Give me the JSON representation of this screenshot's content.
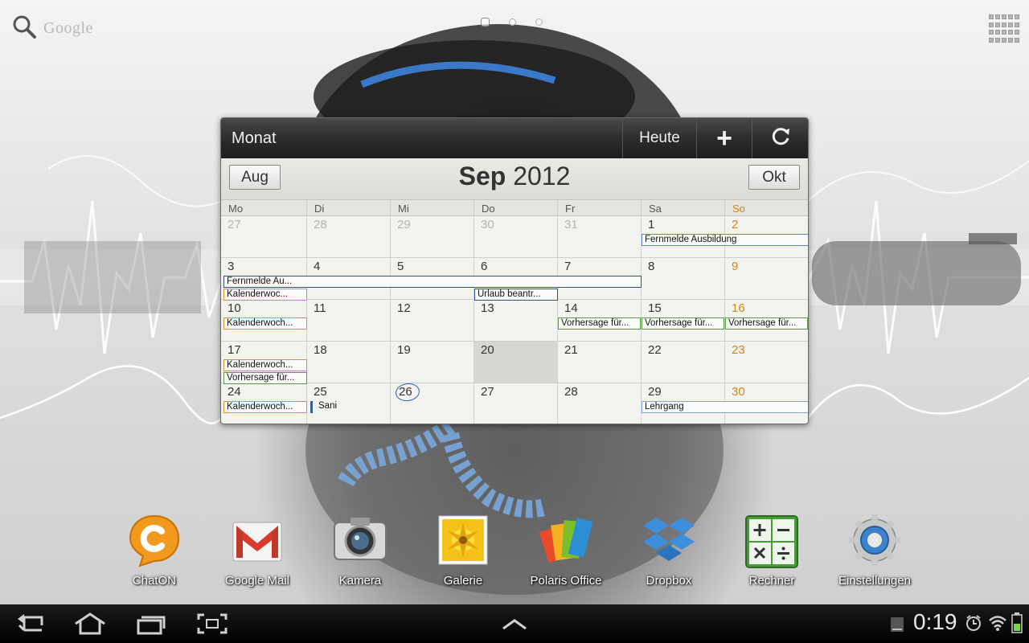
{
  "search": {
    "label": "Google"
  },
  "calendar": {
    "view_label": "Monat",
    "today_label": "Heute",
    "add_label": "+",
    "prev_month": "Aug",
    "next_month": "Okt",
    "month": "Sep",
    "year": "2012",
    "weekdays": [
      "Mo",
      "Di",
      "Mi",
      "Do",
      "Fr",
      "Sa",
      "So"
    ],
    "weeks": [
      [
        "27",
        "28",
        "29",
        "30",
        "31",
        "1",
        "2"
      ],
      [
        "3",
        "4",
        "5",
        "6",
        "7",
        "8",
        "9"
      ],
      [
        "10",
        "11",
        "12",
        "13",
        "14",
        "15",
        "16"
      ],
      [
        "17",
        "18",
        "19",
        "20",
        "21",
        "22",
        "23"
      ],
      [
        "24",
        "25",
        "26",
        "27",
        "28",
        "29",
        "30"
      ]
    ],
    "today": "26",
    "events": {
      "fernmelde_ausbildung": "Fernmelde Ausbildung",
      "fernmelde_au": "Fernmelde Au...",
      "kalenderwoc": "Kalenderwoc...",
      "urlaub": "Urlaub beantr...",
      "kalenderwoch": "Kalenderwoch...",
      "vorhersage": "Vorhersage für...",
      "sani": "Sani",
      "lehrgang": "Lehrgang"
    }
  },
  "dock": [
    {
      "label": "ChatON",
      "icon": "chaton-icon"
    },
    {
      "label": "Google Mail",
      "icon": "gmail-icon"
    },
    {
      "label": "Kamera",
      "icon": "camera-icon"
    },
    {
      "label": "Galerie",
      "icon": "gallery-icon"
    },
    {
      "label": "Polaris Office",
      "icon": "polaris-office-icon"
    },
    {
      "label": "Dropbox",
      "icon": "dropbox-icon"
    },
    {
      "label": "Rechner",
      "icon": "calculator-icon"
    },
    {
      "label": "Einstellungen",
      "icon": "settings-icon"
    }
  ],
  "status": {
    "time": "0:19"
  },
  "colors": {
    "sunday": "#d98316",
    "event_blue": "#5c84c6",
    "event_orange": "#d9913a",
    "event_green": "#5c9a4a",
    "today_circle": "#2b5db0"
  }
}
